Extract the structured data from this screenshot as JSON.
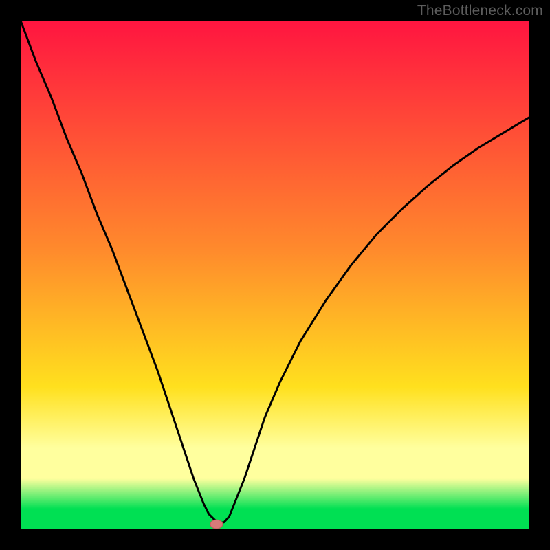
{
  "attribution": "TheBottleneck.com",
  "colors": {
    "frame": "#000000",
    "gradient_top": "#ff1540",
    "gradient_mid1": "#ff8a2c",
    "gradient_mid2": "#ffe01e",
    "gradient_band": "#ffff9e",
    "gradient_bottom": "#00e053",
    "curve": "#000000",
    "marker_fill": "#d77a7a",
    "marker_stroke": "#bd5a5a"
  },
  "chart_data": {
    "type": "line",
    "title": "",
    "xlabel": "",
    "ylabel": "",
    "xlim": [
      0,
      100
    ],
    "ylim": [
      0,
      100
    ],
    "series": [
      {
        "name": "bottleneck-curve",
        "x": [
          0,
          3,
          6,
          9,
          12,
          15,
          18,
          21,
          24,
          27,
          30,
          32,
          34,
          36,
          37,
          38,
          39,
          40,
          41,
          42,
          44,
          46,
          48,
          51,
          55,
          60,
          65,
          70,
          75,
          80,
          85,
          90,
          95,
          100
        ],
        "y": [
          100,
          92,
          85,
          77,
          70,
          62,
          55,
          47,
          39,
          31,
          22,
          16,
          10,
          5,
          3,
          2,
          1.2,
          1.4,
          2.5,
          5,
          10,
          16,
          22,
          29,
          37,
          45,
          52,
          58,
          63,
          67.5,
          71.5,
          75,
          78,
          81
        ]
      }
    ],
    "annotations": [
      {
        "name": "optimal-marker",
        "x": 38.5,
        "y": 1.0
      }
    ],
    "gradient_stops_pct": [
      0,
      45,
      72,
      84,
      90,
      96,
      100
    ]
  }
}
